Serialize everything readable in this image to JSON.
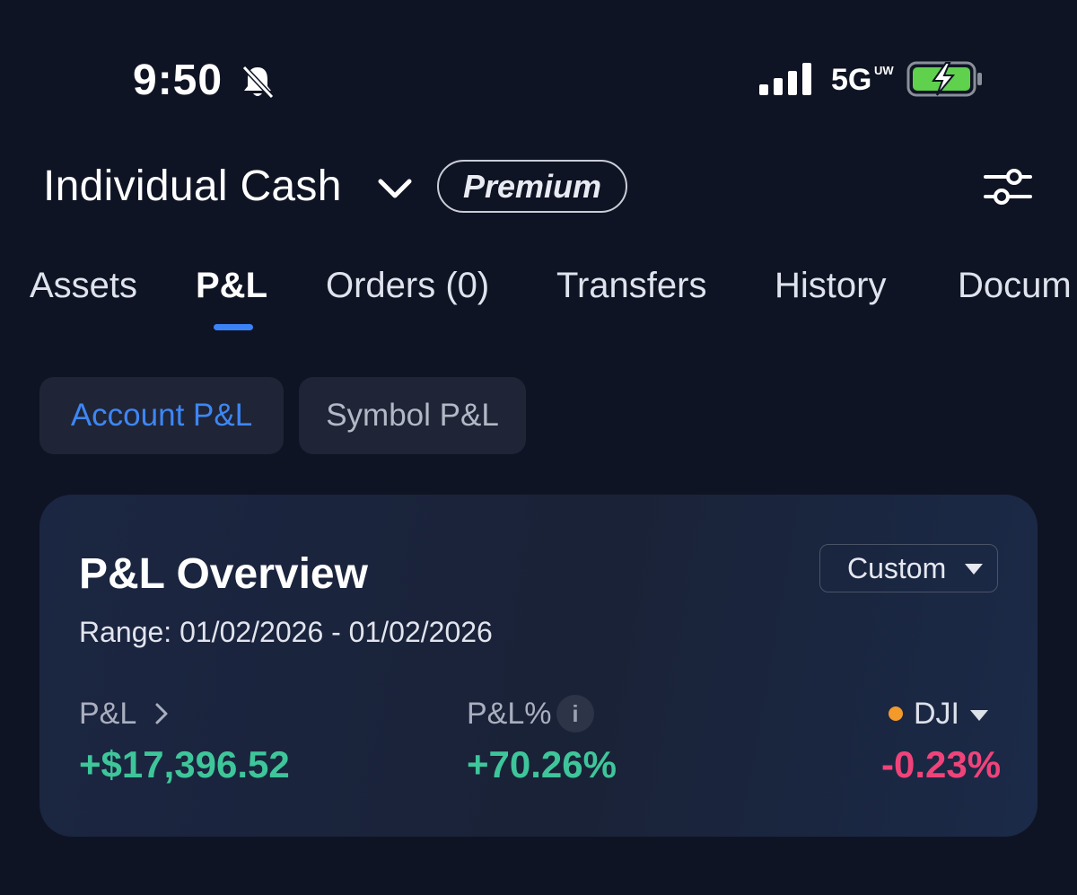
{
  "status_bar": {
    "time": "9:50",
    "network": "5G",
    "network_sup": "UW",
    "icons": [
      "bell-muted-icon",
      "signal-icon",
      "battery-charging-icon"
    ]
  },
  "header": {
    "account_name": "Individual Cash",
    "badge": "Premium"
  },
  "tabs": [
    {
      "label": "Assets",
      "active": false
    },
    {
      "label": "P&L",
      "active": true
    },
    {
      "label": "Orders (0)",
      "active": false
    },
    {
      "label": "Transfers",
      "active": false
    },
    {
      "label": "History",
      "active": false
    },
    {
      "label": "Docum",
      "active": false
    }
  ],
  "segments": {
    "account": "Account P&L",
    "symbol": "Symbol P&L"
  },
  "overview": {
    "title": "P&L Overview",
    "period_select": "Custom",
    "range": "Range: 01/02/2026 - 01/02/2026",
    "pl_label": "P&L",
    "pl_value": "+$17,396.52",
    "pl_pct_label": "P&L%",
    "pl_pct_value": "+70.26%",
    "index_label": "DJI",
    "index_value": "-0.23%"
  },
  "colors": {
    "background": "#0f1424",
    "accent": "#3b82f6",
    "positive": "#3ec69a",
    "negative": "#f0437a",
    "index_dot": "#f39a2b"
  }
}
